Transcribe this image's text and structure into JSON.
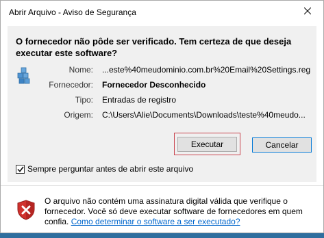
{
  "window": {
    "title": "Abrir Arquivo - Aviso de Segurança",
    "close_icon": "close-icon"
  },
  "main": {
    "question": "O fornecedor não pôde ser verificado. Tem certeza de que deseja executar este software?",
    "app_icon": "registry-file-icon",
    "fields": {
      "name_label": "Nome:",
      "name_value": "...este%40meudominio.com.br%20Email%20Settings.reg",
      "publisher_label": "Fornecedor:",
      "publisher_value": "Fornecedor Desconhecido",
      "type_label": "Tipo:",
      "type_value": "Entradas de registro",
      "origin_label": "Origem:",
      "origin_value": "C:\\Users\\Alie\\Documents\\Downloads\\teste%40meudo..."
    },
    "buttons": {
      "execute": "Executar",
      "cancel": "Cancelar"
    },
    "checkbox": {
      "label": "Sempre perguntar antes de abrir este arquivo",
      "checked": true
    }
  },
  "footer": {
    "icon": "security-shield-icon",
    "text": "O arquivo não contém uma assinatura digital válida que verifique o fornecedor. Você só deve executar software de fornecedores em quem confia.",
    "link": "Como determinar o software a ser executado?"
  },
  "colors": {
    "accent": "#0078d7",
    "focus_border": "#c8414b",
    "link": "#0066cc",
    "shield_red": "#d0312d"
  }
}
